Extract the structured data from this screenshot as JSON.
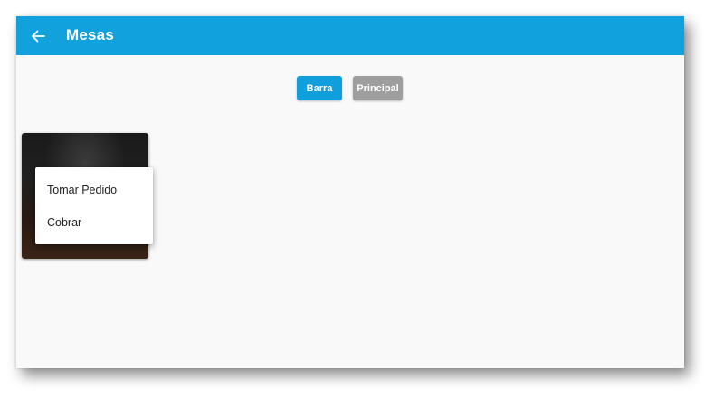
{
  "appbar": {
    "title": "Mesas",
    "back_icon": "arrow-left-icon",
    "color": "#11a1dd"
  },
  "tabs": [
    {
      "label": "Barra",
      "color": "#119fdc",
      "selected": true
    },
    {
      "label": "Principal",
      "color": "#9e9e9e",
      "selected": false
    }
  ],
  "context_menu": {
    "items": [
      {
        "label": "Tomar Pedido"
      },
      {
        "label": "Cobrar"
      }
    ]
  }
}
